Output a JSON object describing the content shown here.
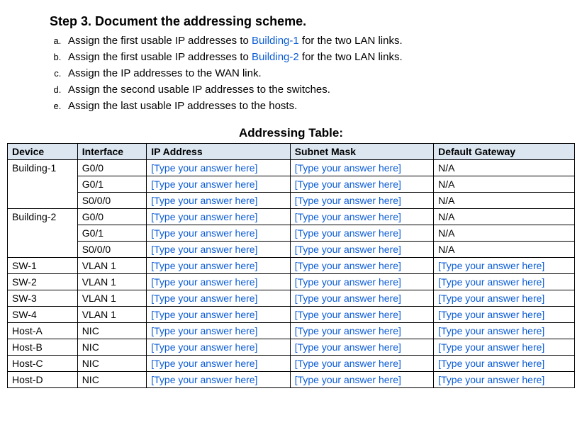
{
  "step": {
    "title": "Step 3. Document the addressing scheme.",
    "items": [
      {
        "prefix": "Assign the first usable IP addresses to ",
        "link": "Building-1",
        "suffix": " for the two LAN links."
      },
      {
        "prefix": "Assign the first usable IP addresses to ",
        "link": "Building-2",
        "suffix": " for the two LAN links."
      },
      {
        "prefix": "Assign the IP addresses to the WAN link.",
        "link": "",
        "suffix": ""
      },
      {
        "prefix": "Assign the second usable IP addresses to the switches.",
        "link": "",
        "suffix": ""
      },
      {
        "prefix": "Assign the last usable IP addresses to the hosts.",
        "link": "",
        "suffix": ""
      }
    ]
  },
  "table_caption": "Addressing Table:",
  "columns": {
    "device": "Device",
    "iface": "Interface",
    "ip": "IP Address",
    "mask": "Subnet Mask",
    "gw": "Default Gateway"
  },
  "placeholder": "[Type your answer here]",
  "na": "N/A",
  "rows": [
    {
      "device": "Building-1",
      "iface": "G0/0",
      "ip": "PH",
      "mask": "PH",
      "gw": "NA",
      "rowspan": 3
    },
    {
      "device": "",
      "iface": "G0/1",
      "ip": "PH",
      "mask": "PH",
      "gw": "NA"
    },
    {
      "device": "",
      "iface": "S0/0/0",
      "ip": "PH",
      "mask": "PH",
      "gw": "NA"
    },
    {
      "device": "Building-2",
      "iface": "G0/0",
      "ip": "PH",
      "mask": "PH",
      "gw": "NA",
      "rowspan": 3
    },
    {
      "device": "",
      "iface": "G0/1",
      "ip": "PH",
      "mask": "PH",
      "gw": "NA"
    },
    {
      "device": "",
      "iface": "S0/0/0",
      "ip": "PH",
      "mask": "PH",
      "gw": "NA"
    },
    {
      "device": "SW-1",
      "iface": "VLAN 1",
      "ip": "PH",
      "mask": "PH",
      "gw": "PH"
    },
    {
      "device": "SW-2",
      "iface": "VLAN 1",
      "ip": "PH",
      "mask": "PH",
      "gw": "PH"
    },
    {
      "device": "SW-3",
      "iface": "VLAN 1",
      "ip": "PH",
      "mask": "PH",
      "gw": "PH"
    },
    {
      "device": "SW-4",
      "iface": "VLAN 1",
      "ip": "PH",
      "mask": "PH",
      "gw": "PH"
    },
    {
      "device": "Host-A",
      "iface": "NIC",
      "ip": "PH",
      "mask": "PH",
      "gw": "PH"
    },
    {
      "device": "Host-B",
      "iface": "NIC",
      "ip": "PH",
      "mask": "PH",
      "gw": "PH"
    },
    {
      "device": "Host-C",
      "iface": "NIC",
      "ip": "PH",
      "mask": "PH",
      "gw": "PH"
    },
    {
      "device": "Host-D",
      "iface": "NIC",
      "ip": "PH",
      "mask": "PH",
      "gw": "PH"
    }
  ]
}
